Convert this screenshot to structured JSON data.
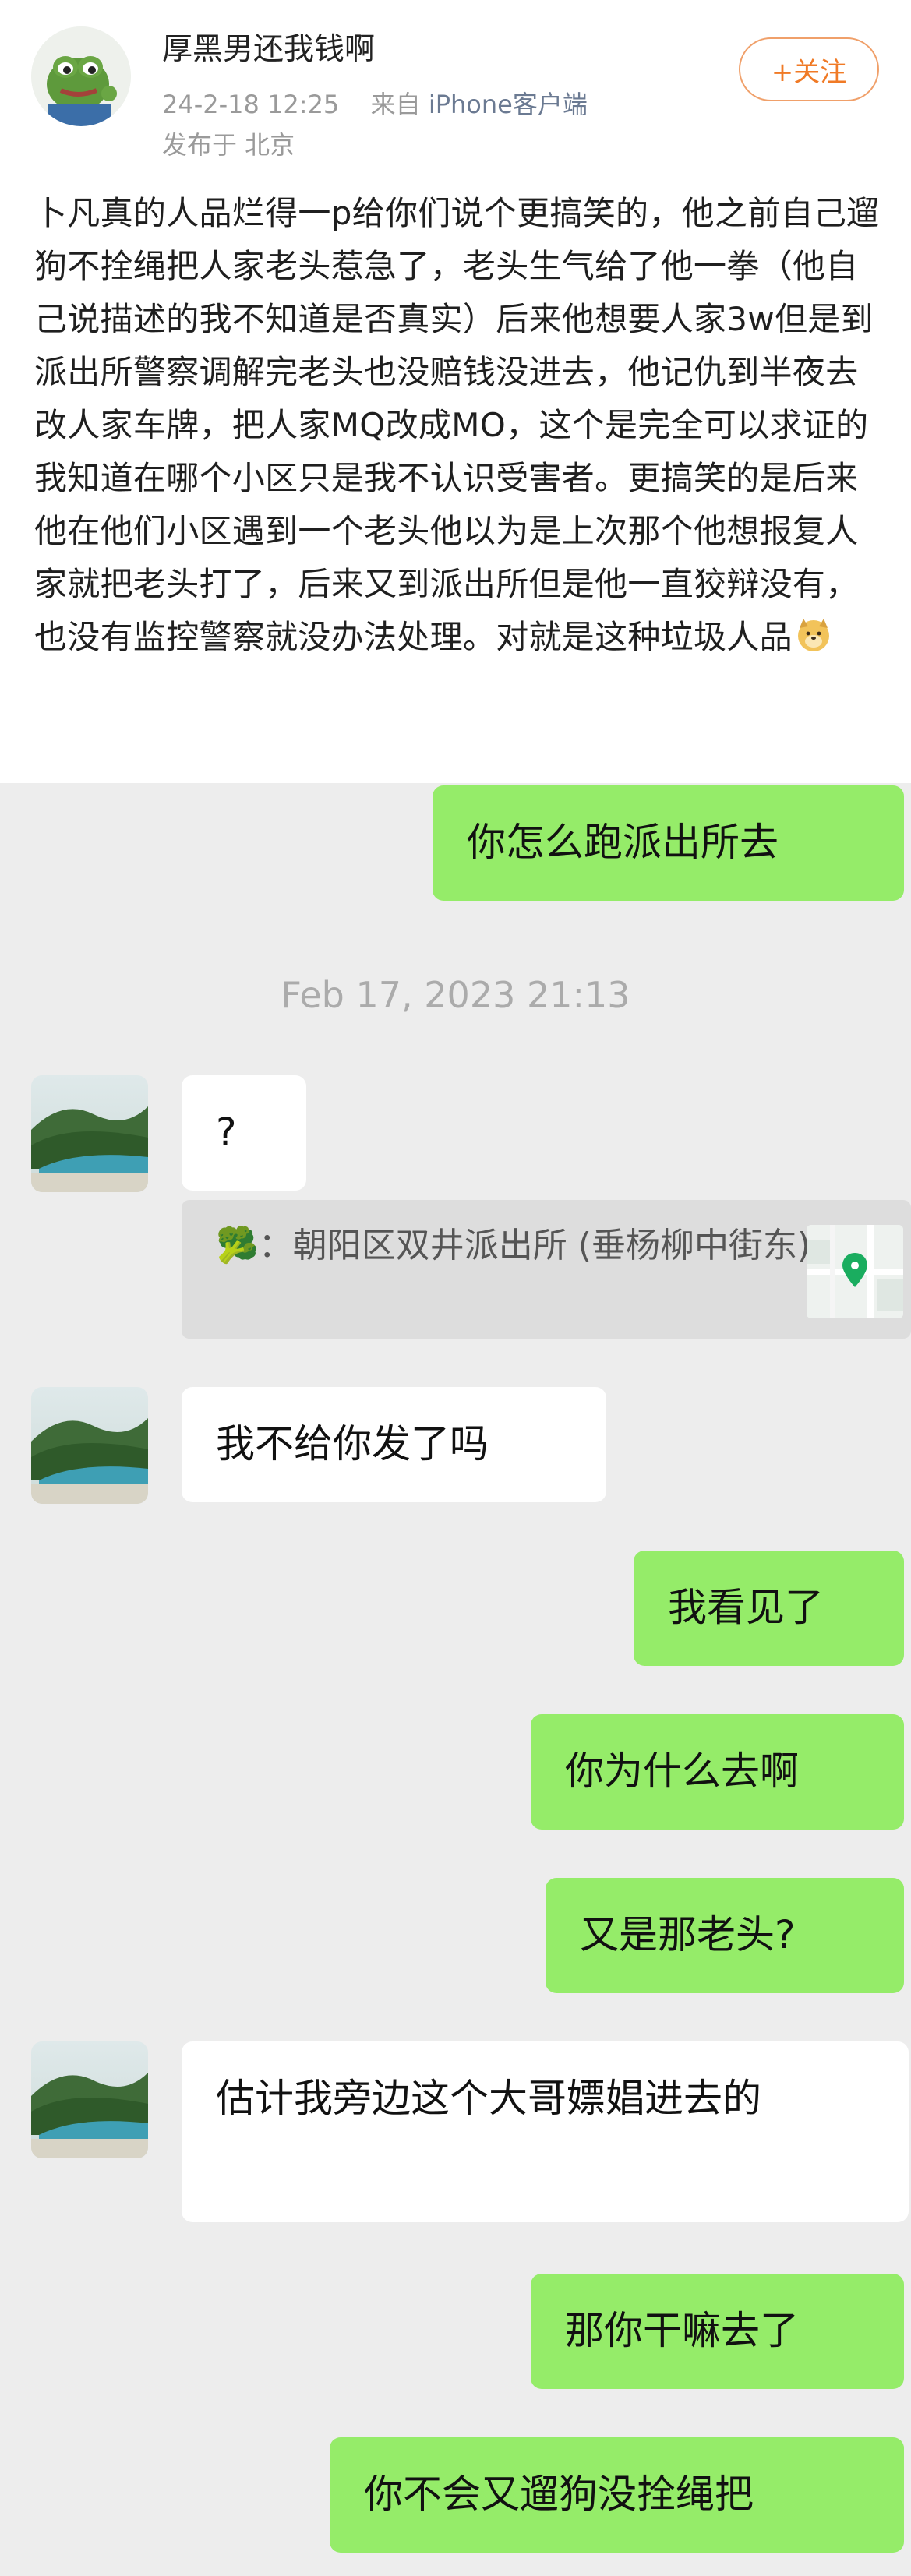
{
  "post": {
    "username": "厚黑男还我钱啊",
    "date": "24-2-18 12:25",
    "source_prefix": "来自",
    "source": "iPhone客户端",
    "location": "发布于 北京",
    "follow_label": "+关注",
    "body": "卜凡真的人品烂得一p给你们说个更搞笑的，他之前自己遛狗不拴绳把人家老头惹急了，老头生气给了他一拳（他自己说描述的我不知道是否真实）后来他想要人家3w但是到派出所警察调解完老头也没赔钱没进去，他记仇到半夜去改人家车牌，把人家MQ改成MO，这个是完全可以求证的我知道在哪个小区只是我不认识受害者。更搞笑的是后来他在他们小区遇到一个老头他以为是上次那个他想报复人家就把老头打了，后来又到派出所但是他一直狡辩没有，也没有监控警察就没办法处理。对就是这种垃圾人品",
    "emoji": "doge-icon"
  },
  "chat": {
    "timestamp": "Feb 17, 2023 21:13",
    "messages": [
      {
        "side": "out",
        "text": "你怎么跑派出所去"
      },
      {
        "side": "in",
        "text": "?"
      },
      {
        "side": "in",
        "text": "我不给你发了吗"
      },
      {
        "side": "out",
        "text": "我看见了"
      },
      {
        "side": "out",
        "text": "你为什么去啊"
      },
      {
        "side": "out",
        "text": "又是那老头?"
      },
      {
        "side": "in",
        "text": "估计我旁边这个大哥嫖娼进去的"
      },
      {
        "side": "out",
        "text": "那你干嘛去了"
      },
      {
        "side": "out",
        "text": "你不会又遛狗没拴绳把"
      }
    ],
    "quote": {
      "emoji": "🥦",
      "text": "：朝阳区双井派出所 (垂杨柳中街东)",
      "icon": "location-pin-icon"
    }
  },
  "colors": {
    "out_bubble": "#95ec69",
    "in_bubble": "#ffffff",
    "chat_bg": "#ededed",
    "follow": "#f07a26"
  }
}
